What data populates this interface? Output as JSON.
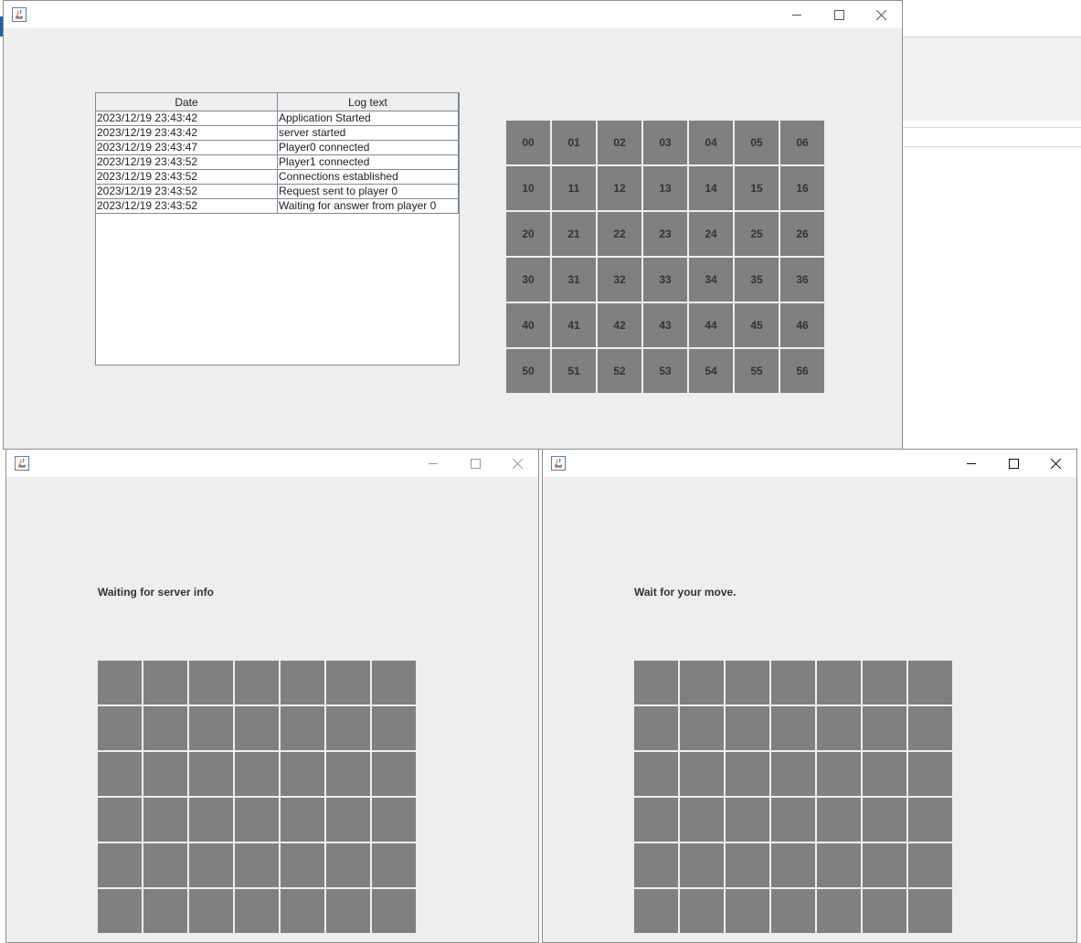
{
  "server_window": {
    "log_table": {
      "headers": [
        "Date",
        "Log text"
      ],
      "rows": [
        [
          "2023/12/19 23:43:42",
          "Application Started"
        ],
        [
          "2023/12/19 23:43:42",
          "server started"
        ],
        [
          "2023/12/19 23:43:47",
          "Player0 connected"
        ],
        [
          "2023/12/19 23:43:52",
          "Player1 connected"
        ],
        [
          "2023/12/19 23:43:52",
          "Connections established"
        ],
        [
          "2023/12/19 23:43:52",
          "Request sent to player 0"
        ],
        [
          "2023/12/19 23:43:52",
          "Waiting for answer from player 0"
        ]
      ]
    },
    "board_labels": [
      [
        "00",
        "01",
        "02",
        "03",
        "04",
        "05",
        "06"
      ],
      [
        "10",
        "11",
        "12",
        "13",
        "14",
        "15",
        "16"
      ],
      [
        "20",
        "21",
        "22",
        "23",
        "24",
        "25",
        "26"
      ],
      [
        "30",
        "31",
        "32",
        "33",
        "34",
        "35",
        "36"
      ],
      [
        "40",
        "41",
        "42",
        "43",
        "44",
        "45",
        "46"
      ],
      [
        "50",
        "51",
        "52",
        "53",
        "54",
        "55",
        "56"
      ]
    ]
  },
  "client_window_left": {
    "status_text": "Waiting for server info",
    "board_rows": 6,
    "board_cols": 7
  },
  "client_window_right": {
    "status_text": "Wait for your move.",
    "board_rows": 6,
    "board_cols": 7
  },
  "colors": {
    "cell": "#808080",
    "window_bg": "#eeeeee",
    "titlebar": "#ffffff"
  },
  "icons": {
    "app": "java-app-icon",
    "minimize": "minimize-icon",
    "maximize": "maximize-icon",
    "close": "close-icon"
  }
}
